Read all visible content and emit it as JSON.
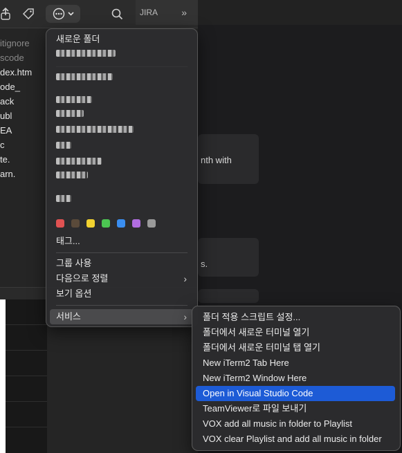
{
  "finder": {
    "toolbar": {
      "tag_icon": "tag-icon",
      "more_icon": "ellipsis-circle-icon",
      "search_icon": "search-icon",
      "jira_tab": "JIRA",
      "overflow": "»"
    },
    "files": [
      {
        "name": "itignore",
        "dim": true
      },
      {
        "name": "scode",
        "dim": true
      },
      {
        "name": "dex.htm",
        "dim": false
      },
      {
        "name": "ode_",
        "dim": false
      },
      {
        "name": "ack",
        "dim": false
      },
      {
        "name": "ubl",
        "dim": false
      },
      {
        "name": "EA",
        "dim": false
      },
      {
        "name": "c",
        "dim": false
      },
      {
        "name": "te.",
        "dim": false
      },
      {
        "name": "arn.",
        "dim": false
      }
    ]
  },
  "right_panel": {
    "card1_text": "nth with",
    "card2_text": "s."
  },
  "context_menu": {
    "new_folder": "새로운 폴더",
    "tags_label": "태그...",
    "use_groups": "그룹 사용",
    "sort_by": "다음으로 정렬",
    "view_options": "보기 옵션",
    "services": "서비스",
    "tag_colors": [
      "#e05252",
      "#f0a030",
      "#f2d230",
      "#4cc552",
      "#3a8ef0",
      "#b16de0",
      "#9a9a9a"
    ]
  },
  "services_submenu": {
    "items": [
      "폴더 적용 스크립트 설정...",
      "폴더에서 새로운 터미널 열기",
      "폴더에서 새로운 터미널 탭 열기",
      "New iTerm2 Tab Here",
      "New iTerm2 Window Here",
      "Open in Visual Studio Code",
      "TeamViewer로 파일 보내기",
      "VOX add all music in folder to Playlist",
      "VOX clear Playlist and add all music in folder"
    ],
    "highlight_color": "#1d5bd6"
  }
}
